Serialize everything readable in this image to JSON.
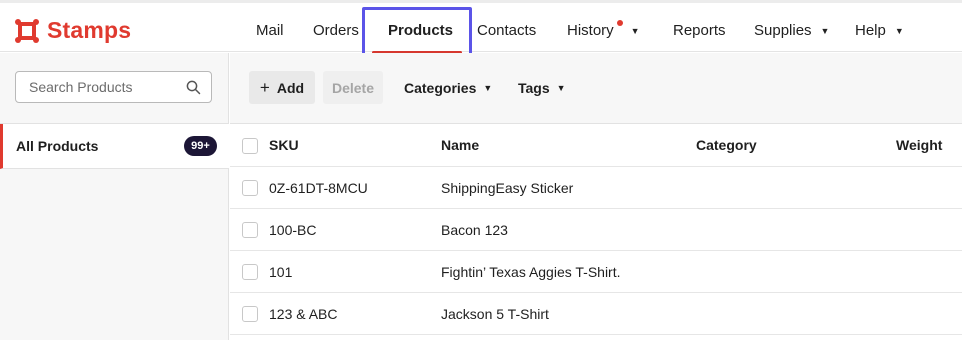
{
  "brand": {
    "name": "Stamps",
    "color": "#e03a2f"
  },
  "nav": {
    "items": [
      {
        "label": "Mail"
      },
      {
        "label": "Orders"
      },
      {
        "label": "Products",
        "active": true
      },
      {
        "label": "Contacts"
      },
      {
        "label": "History",
        "has_dropdown": true,
        "has_notification": true
      },
      {
        "label": "Reports"
      },
      {
        "label": "Supplies",
        "has_dropdown": true
      },
      {
        "label": "Help",
        "has_dropdown": true
      }
    ]
  },
  "sidebar": {
    "search_placeholder": "Search Products",
    "items": [
      {
        "label": "All Products",
        "badge": "99+",
        "active": true
      }
    ]
  },
  "toolbar": {
    "add_label": "Add",
    "delete_label": "Delete",
    "categories_label": "Categories",
    "tags_label": "Tags"
  },
  "table": {
    "columns": [
      "SKU",
      "Name",
      "Category",
      "Weight"
    ],
    "rows": [
      {
        "sku": "0Z-61DT-8MCU",
        "name": "ShippingEasy Sticker",
        "category": "",
        "weight": ""
      },
      {
        "sku": "100-BC",
        "name": "Bacon 123",
        "category": "",
        "weight": ""
      },
      {
        "sku": "101",
        "name": "Fightin’ Texas Aggies T-Shirt.",
        "category": "",
        "weight": ""
      },
      {
        "sku": "123 & ABC",
        "name": "Jackson 5 T-Shirt",
        "category": "",
        "weight": ""
      }
    ]
  },
  "colors": {
    "accent": "#e03a2f",
    "focus": "#5b54e8",
    "badge_bg": "#1c1636"
  }
}
